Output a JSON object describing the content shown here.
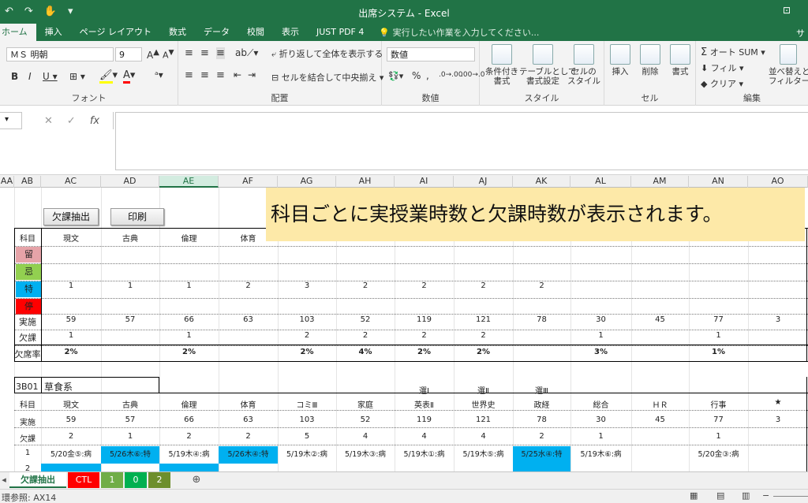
{
  "window": {
    "title": "出席システム - Excel",
    "help_icon": "restore-icon",
    "right_tab": "サ"
  },
  "tabs": [
    {
      "label": "ホーム",
      "active": true
    },
    {
      "label": "挿入"
    },
    {
      "label": "ページ レイアウト"
    },
    {
      "label": "数式"
    },
    {
      "label": "データ"
    },
    {
      "label": "校閲"
    },
    {
      "label": "表示"
    },
    {
      "label": "JUST PDF 4"
    }
  ],
  "tell_me": "実行したい作業を入力してください...",
  "ribbon": {
    "font_name": "ＭＳ 明朝",
    "font_size": "9",
    "font_group": "フォント",
    "wrap_text": "折り返して全体を表示する",
    "merge_center": "セルを結合して中央揃え",
    "align_group": "配置",
    "number_format": "数値",
    "number_group": "数値",
    "cond_format": "条件付き\n書式",
    "table_format": "テーブルとして\n書式設定",
    "cell_style": "セルの\nスタイル",
    "style_group": "スタイル",
    "insert": "挿入",
    "delete": "削除",
    "format": "書式",
    "cells_group": "セル",
    "autosum": "オート SUM",
    "fill": "フィル",
    "clear": "クリア",
    "sort_filter": "並べ替えと\nフィルター",
    "edit_group": "編集"
  },
  "formula_bar": {
    "fx": "fx",
    "cancel": "✕",
    "confirm": "✓"
  },
  "columns": [
    "AA",
    "AB",
    "AC",
    "AD",
    "AE",
    "AF",
    "AG",
    "AH",
    "AI",
    "AJ",
    "AK",
    "AL",
    "AM",
    "AN",
    "AO"
  ],
  "buttons": {
    "extract": "欠課抽出",
    "print": "印刷"
  },
  "callout": "科目ごとに実授業時数と欠課時数が表示されます。",
  "summary_table": {
    "header": [
      "科目",
      "現文",
      "古典",
      "倫理",
      "体育",
      "",
      "",
      "",
      "",
      "",
      "",
      "",
      ""
    ],
    "labels": [
      "留",
      "忌",
      "特",
      "停"
    ],
    "toku": [
      "1",
      "1",
      "1",
      "2",
      "3",
      "2",
      "2",
      "2",
      "2",
      "",
      "",
      ""
    ],
    "jisshi_label": "実施",
    "jisshi": [
      "59",
      "57",
      "66",
      "63",
      "103",
      "52",
      "119",
      "121",
      "78",
      "30",
      "45",
      "77",
      "3"
    ],
    "kekka_label": "欠課",
    "kekka": [
      "1",
      "",
      "1",
      "",
      "2",
      "2",
      "2",
      "2",
      "",
      "1",
      "",
      "1",
      ""
    ],
    "rate_label": "欠席率",
    "rate": [
      "2%",
      "",
      "2%",
      "",
      "2%",
      "4%",
      "2%",
      "2%",
      "",
      "3%",
      "",
      "1%",
      ""
    ]
  },
  "student_table": {
    "class_code": "3B01",
    "name": "草食系",
    "sen": [
      "",
      "",
      "",
      "",
      "",
      "",
      "選Ⅰ",
      "選Ⅱ",
      "選Ⅲ",
      "",
      "",
      "",
      ""
    ],
    "header": [
      "科目",
      "現文",
      "古典",
      "倫理",
      "体育",
      "コミⅢ",
      "家庭",
      "英表Ⅱ",
      "世界史",
      "政経",
      "総合",
      "ＨＲ",
      "行事",
      "★"
    ],
    "jisshi": [
      "実施",
      "59",
      "57",
      "66",
      "63",
      "103",
      "52",
      "119",
      "121",
      "78",
      "30",
      "45",
      "77",
      "3"
    ],
    "kekka": [
      "欠課",
      "2",
      "1",
      "2",
      "2",
      "5",
      "4",
      "4",
      "4",
      "2",
      "1",
      "",
      "1",
      ""
    ],
    "row1_no": "1",
    "row1": [
      "5/20金⑤:病",
      "5/26木⑥:特",
      "5/19木④:病",
      "5/26木④:特",
      "5/19木②:病",
      "5/19木③:病",
      "5/19木①:病",
      "5/19木⑤:病",
      "5/25水④:特",
      "5/19木⑥:病",
      "",
      "5/20金③:病",
      ""
    ],
    "row2_no": "2"
  },
  "sheet_tabs": [
    {
      "label": "欠課抽出",
      "color": "#ffffff"
    },
    {
      "label": "CTL",
      "color": "#ff0000"
    },
    {
      "label": "1",
      "color": "#70ad47"
    },
    {
      "label": "0",
      "color": "#00b050"
    },
    {
      "label": "2",
      "color": "#6d8f2d"
    }
  ],
  "status": "環参照: AX14",
  "colors": {
    "accent": "#217346",
    "cyan": "#00b0f0",
    "ryu": "#e6a3a8",
    "ki": "#92d050",
    "toku": "#00b0f0",
    "tei": "#ff0000",
    "callout": "#fde9a8"
  }
}
